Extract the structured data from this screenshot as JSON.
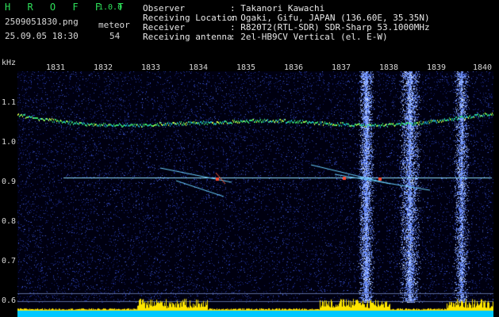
{
  "app": {
    "brand": "H R O F F T",
    "version": "1.0.0",
    "filename": "2509051830.png",
    "datetime": "25.09.05 18:30",
    "meteor_label": "meteor",
    "meteor_count": "54"
  },
  "info": [
    {
      "key": "Observer",
      "value": ": Takanori Kawachi"
    },
    {
      "key": "Receiving Location",
      "value": ": Ogaki, Gifu, JAPAN (136.60E, 35.35N)"
    },
    {
      "key": "Receiver",
      "value": ": R820T2(RTL-SDR) SDR-Sharp 53.1000MHz"
    },
    {
      "key": "Receiving antenna",
      "value": ": 2el-HB9CV Vertical (el. E-W)"
    }
  ],
  "axis": {
    "y_unit": "kHz",
    "y_ticks": [
      "1.1",
      "1.0",
      "0.9",
      "0.8",
      "0.7",
      "0.6"
    ],
    "x_ticks": [
      "1831",
      "1832",
      "1833",
      "1834",
      "1835",
      "1836",
      "1837",
      "1838",
      "1839",
      "1840"
    ]
  },
  "colors": {
    "background": "#000000",
    "noise": "#1a2a8a",
    "signal": "#39e06a",
    "carrier": "#7fd8ff",
    "bar": "#ffe600"
  }
}
